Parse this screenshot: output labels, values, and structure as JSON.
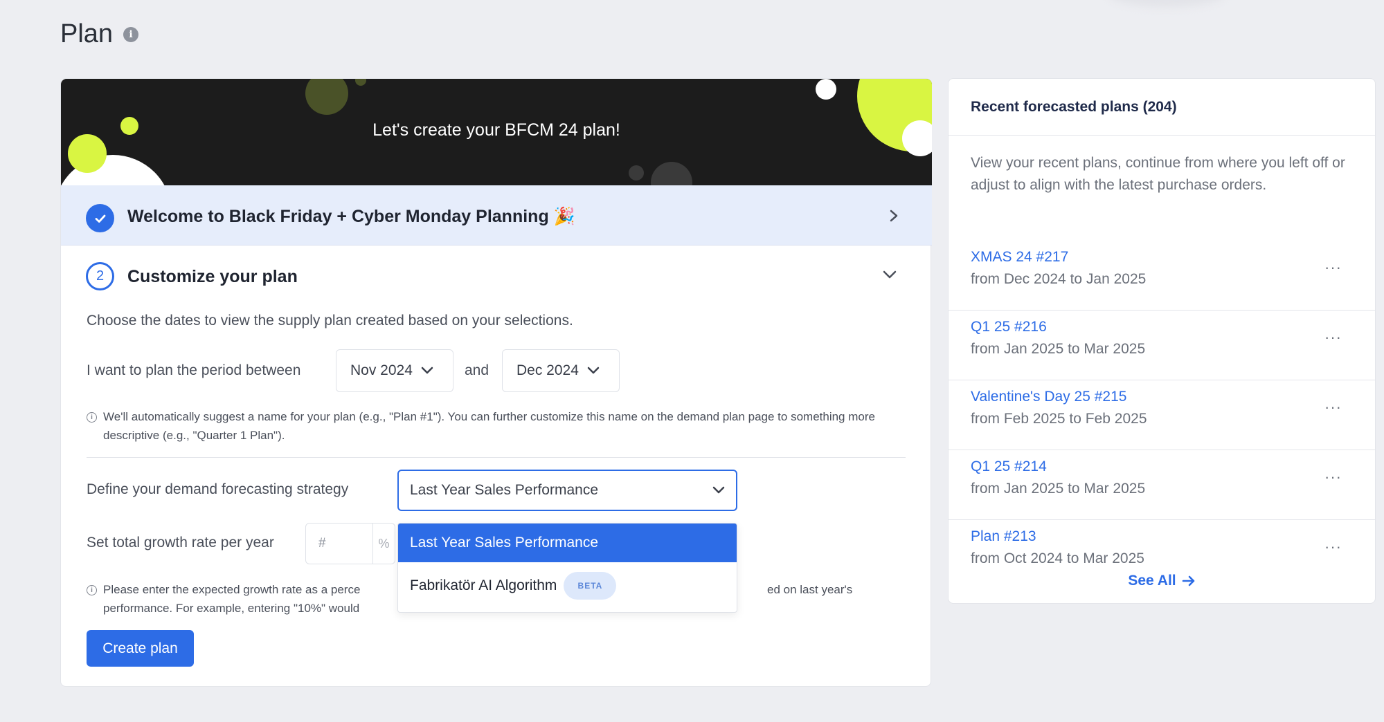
{
  "page": {
    "title": "Plan",
    "info_icon": "info-icon"
  },
  "banner": {
    "title": "Let's create your BFCM 24 plan!"
  },
  "step1": {
    "title": "Welcome to Black Friday + Cyber Monday Planning 🎉",
    "status": "completed"
  },
  "step2": {
    "number": "2",
    "title": "Customize your plan",
    "description": "Choose the dates to view the supply plan created based on your selections.",
    "period_label": "I want to plan the period between",
    "start_month": "Nov 2024",
    "and_label": "and",
    "end_month": "Dec 2024",
    "name_note": "We'll automatically suggest a name for your plan (e.g., \"Plan #1\"). You can further customize this name on the demand plan page to something more descriptive (e.g., \"Quarter 1 Plan\").",
    "strategy_label": "Define your demand forecasting strategy",
    "strategy_value": "Last Year Sales Performance",
    "strategy_options": [
      {
        "label": "Last Year Sales Performance",
        "selected": true
      },
      {
        "label": "Fabrikatör AI Algorithm",
        "badge": "BETA",
        "selected": false
      }
    ],
    "growth_label": "Set total growth rate per year",
    "growth_placeholder": "#",
    "growth_unit": "%",
    "growth_note_left": "Please enter the expected growth rate as a perce",
    "growth_note_right": "ed on last year's",
    "growth_note_line2": "performance. For example, entering \"10%\" would",
    "create_button": "Create plan"
  },
  "recent": {
    "title": "Recent forecasted plans (204)",
    "description": "View your recent plans, continue from where you left off or adjust to align with the latest purchase orders.",
    "plans": [
      {
        "name": "XMAS 24 #217",
        "dates": "from Dec 2024 to Jan 2025"
      },
      {
        "name": "Q1 25 #216",
        "dates": "from Jan 2025 to Mar 2025"
      },
      {
        "name": "Valentine's Day 25 #215",
        "dates": "from Feb 2025 to Feb 2025"
      },
      {
        "name": "Q1 25 #214",
        "dates": "from Jan 2025 to Mar 2025"
      },
      {
        "name": "Plan #213",
        "dates": "from Oct 2024 to Mar 2025"
      }
    ],
    "more_label": "···",
    "see_all": "See All"
  },
  "colors": {
    "accent": "#2d6ce6",
    "lime": "#d9f542",
    "banner_bg": "#1c1c1c"
  }
}
